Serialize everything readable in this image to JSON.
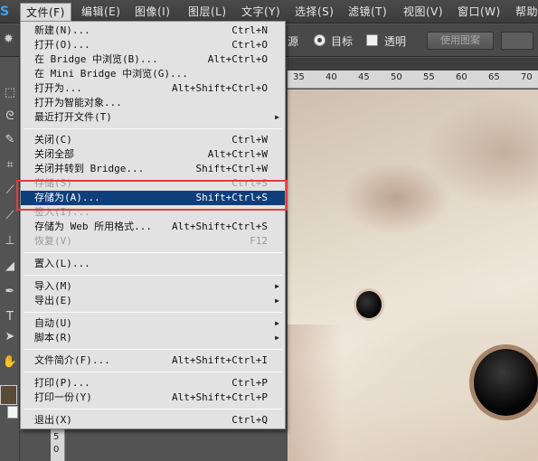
{
  "app": {
    "logo_text": "S",
    "menu_bar": [
      "文件(F)",
      "编辑(E)",
      "图像(I)",
      "图层(L)",
      "文字(Y)",
      "选择(S)",
      "滤镜(T)",
      "视图(V)",
      "窗口(W)",
      "帮助"
    ]
  },
  "options_bar": {
    "source_label": "源",
    "target_label": "目标",
    "transparent_label": "透明",
    "use_pattern_button": "使用图案"
  },
  "ruler": {
    "top_ticks": [
      "35",
      "40",
      "45",
      "50",
      "55",
      "60",
      "65",
      "70"
    ],
    "left_ticks": [
      "5",
      "0"
    ]
  },
  "file_menu": {
    "items": [
      {
        "label": "新建(N)...",
        "shortcut": "Ctrl+N"
      },
      {
        "label": "打开(O)...",
        "shortcut": "Ctrl+O"
      },
      {
        "label": "在 Bridge 中浏览(B)...",
        "shortcut": "Alt+Ctrl+O"
      },
      {
        "label": "在 Mini Bridge 中浏览(G)...",
        "shortcut": ""
      },
      {
        "label": "打开为...",
        "shortcut": "Alt+Shift+Ctrl+O"
      },
      {
        "label": "打开为智能对象...",
        "shortcut": ""
      },
      {
        "label": "最近打开文件(T)",
        "shortcut": ""
      },
      {
        "label": "关闭(C)",
        "shortcut": "Ctrl+W"
      },
      {
        "label": "关闭全部",
        "shortcut": "Alt+Ctrl+W"
      },
      {
        "label": "关闭并转到 Bridge...",
        "shortcut": "Shift+Ctrl+W"
      },
      {
        "label": "存储(S)",
        "shortcut": "Ctrl+S"
      },
      {
        "label": "存储为(A)...",
        "shortcut": "Shift+Ctrl+S"
      },
      {
        "label": "签入(I)...",
        "shortcut": ""
      },
      {
        "label": "存储为 Web 所用格式...",
        "shortcut": "Alt+Shift+Ctrl+S"
      },
      {
        "label": "恢复(V)",
        "shortcut": "F12"
      },
      {
        "label": "置入(L)...",
        "shortcut": ""
      },
      {
        "label": "导入(M)",
        "shortcut": ""
      },
      {
        "label": "导出(E)",
        "shortcut": ""
      },
      {
        "label": "自动(U)",
        "shortcut": ""
      },
      {
        "label": "脚本(R)",
        "shortcut": ""
      },
      {
        "label": "文件简介(F)...",
        "shortcut": "Alt+Shift+Ctrl+I"
      },
      {
        "label": "打印(P)...",
        "shortcut": "Ctrl+P"
      },
      {
        "label": "打印一份(Y)",
        "shortcut": "Alt+Shift+Ctrl+P"
      },
      {
        "label": "退出(X)",
        "shortcut": "Ctrl+Q"
      }
    ]
  },
  "colors": {
    "highlight": "#0e3f7a",
    "annotation_frame": "#e63b3b",
    "menu_bg": "#e2e2e2"
  }
}
